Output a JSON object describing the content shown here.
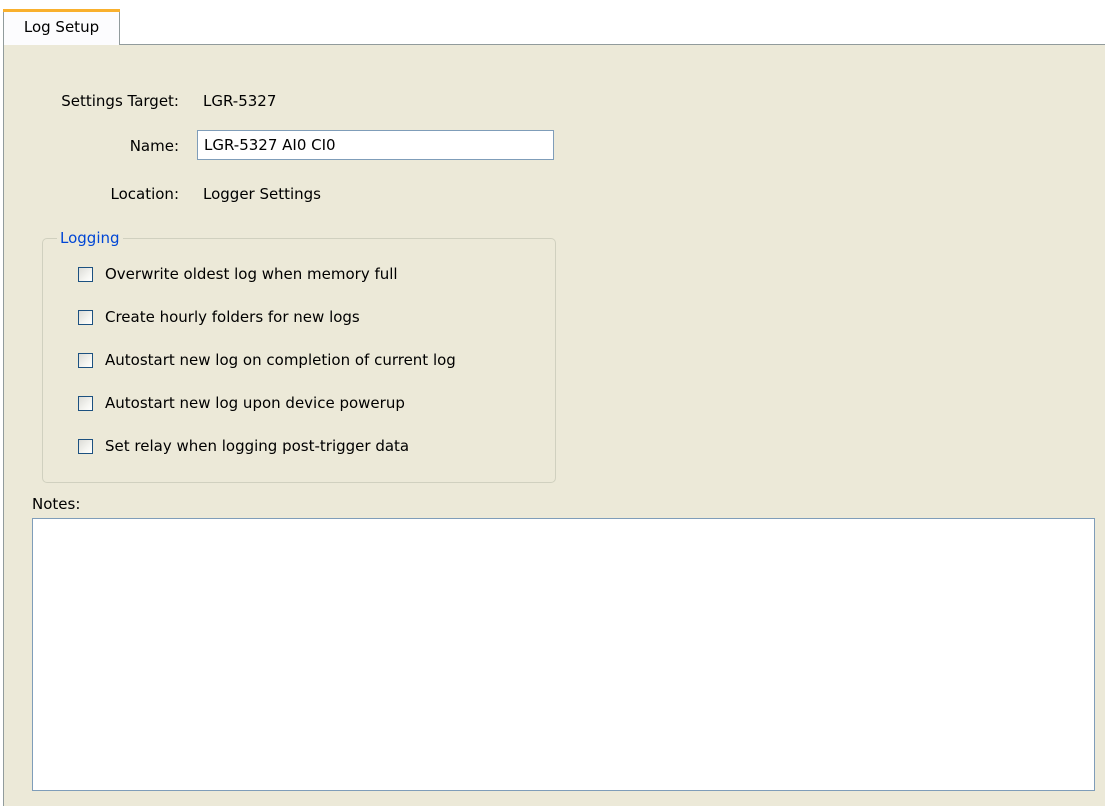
{
  "tabs": [
    {
      "label": "Log Setup",
      "active": true
    }
  ],
  "settings": {
    "target_label": "Settings Target:",
    "target_value": "LGR-5327",
    "name_label": "Name:",
    "name_value": "LGR-5327 AI0 CI0",
    "location_label": "Location:",
    "location_value": "Logger Settings"
  },
  "logging": {
    "title": "Logging",
    "options": [
      {
        "label": "Overwrite oldest log when memory full",
        "checked": false
      },
      {
        "label": "Create hourly folders for new logs",
        "checked": false
      },
      {
        "label": "Autostart new log on completion of current log",
        "checked": false
      },
      {
        "label": "Autostart new log upon device powerup",
        "checked": false
      },
      {
        "label": "Set relay when logging post-trigger data",
        "checked": false
      }
    ]
  },
  "notes": {
    "label": "Notes:",
    "value": ""
  },
  "colors": {
    "panel_background": "#ece9d8",
    "tab_highlight": "#f9b02d",
    "group_title": "#0046d5",
    "input_border": "#7f9db9"
  }
}
